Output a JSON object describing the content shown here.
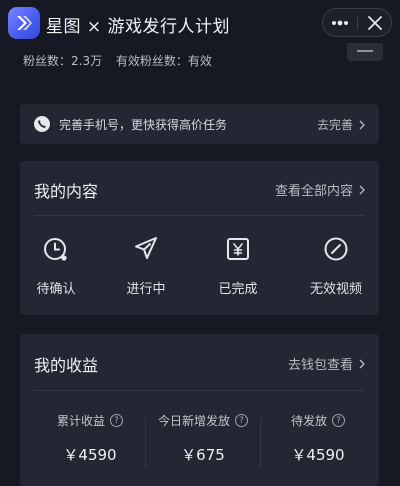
{
  "header": {
    "title": "星图 × 游戏发行人计划",
    "more_icon": "more-dots-icon",
    "close_icon": "close-icon"
  },
  "profile": {
    "fans_text": "粉丝数：2.3万",
    "valid_fans_text": "有效粉丝数：有效"
  },
  "phone_banner": {
    "text": "完善手机号，更快获得高价任务",
    "action": "去完善"
  },
  "content": {
    "title": "我的内容",
    "view_all": "查看全部内容",
    "statuses": [
      {
        "label": "待确认",
        "icon": "clock-icon"
      },
      {
        "label": "进行中",
        "icon": "send-icon"
      },
      {
        "label": "已完成",
        "icon": "yen-tag-icon"
      },
      {
        "label": "无效视频",
        "icon": "invalid-icon"
      }
    ]
  },
  "income": {
    "title": "我的收益",
    "wallet_link": "去钱包查看",
    "stats": [
      {
        "name": "累计收益",
        "value": "￥4590"
      },
      {
        "name": "今日新增发放",
        "value": "￥675"
      },
      {
        "name": "待发放",
        "value": "￥4590"
      }
    ]
  },
  "colors": {
    "background": "#161823",
    "card": "#242633",
    "accent": "#4a5cf0"
  }
}
